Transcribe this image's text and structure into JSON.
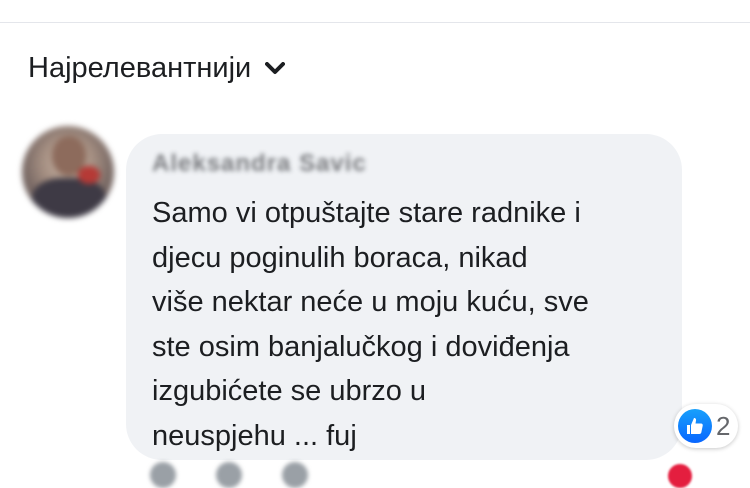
{
  "sort": {
    "label": "Најрелевантнији",
    "icon": "chevron-down-icon"
  },
  "comment": {
    "author": "Aleksandra Savic",
    "lines": [
      "Samo vi otpuštajte stare radnike i",
      "djecu poginulih boraca, nikad",
      "više nektar neće u moju kuću, sve",
      "ste osim banjalučkog i  doviđenja",
      "izgubićete se ubrzo u",
      "neuspjehu ... fuj"
    ],
    "reaction_count": "2"
  },
  "colors": {
    "like_blue": "#0866ff",
    "bubble": "#f0f2f5",
    "secondary_text": "#65676b"
  }
}
